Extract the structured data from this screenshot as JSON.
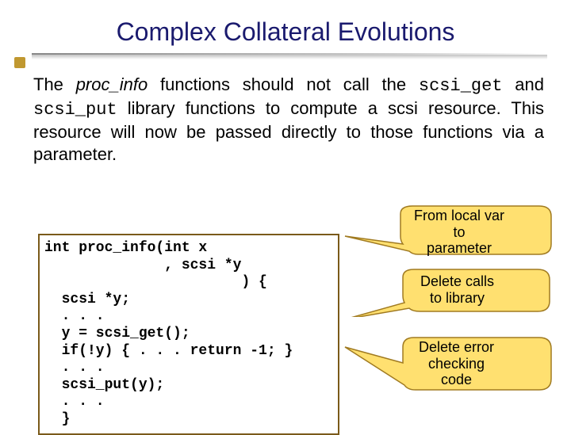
{
  "title": "Complex Collateral Evolutions",
  "para": {
    "t1": "The ",
    "proc_info": "proc_info",
    "t2": " functions should not call the ",
    "scsi_get": "scsi_get",
    "t3": " and ",
    "scsi_put": "scsi_put",
    "t4": " library functions to compute a scsi resource. This resource will now be passed directly to those functions via a parameter."
  },
  "callouts": {
    "c1a": "From local var",
    "c1b": "to",
    "c1c": "parameter",
    "c2a": "Delete calls",
    "c2b": "to library",
    "c3a": "Delete error",
    "c3b": "checking",
    "c3c": "code"
  },
  "code": {
    "l1": "int proc_info(int x",
    "l2": "              , scsi *y",
    "l3": "                       ) {",
    "l4": "  scsi *y;",
    "l5": "  . . .",
    "l6": "  y = scsi_get();",
    "l7": "  if(!y) { . . . return -1; }",
    "l8": "  . . .",
    "l9": "  scsi_put(y);",
    "l10": "  . . .",
    "l11": "  }"
  }
}
